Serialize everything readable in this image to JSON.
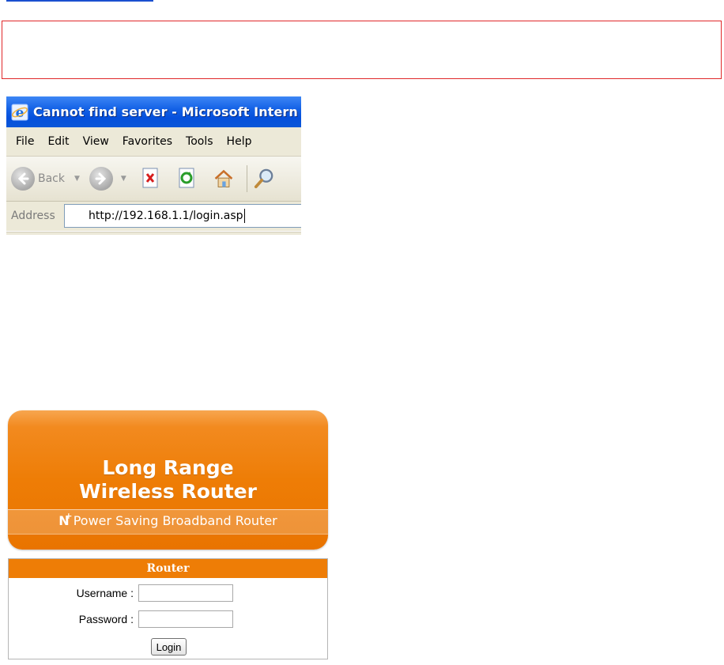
{
  "ie_window": {
    "title": "Cannot find server - Microsoft Intern",
    "menu": [
      "File",
      "Edit",
      "View",
      "Favorites",
      "Tools",
      "Help"
    ],
    "toolbar": {
      "back_label": "Back"
    },
    "address": {
      "label": "Address",
      "url": "http://192.168.1.1/login.asp"
    }
  },
  "banner": {
    "title_line1": "Long Range",
    "title_line2": "Wireless Router",
    "subtitle_prefix": "N",
    "subtitle_sup": "+",
    "subtitle_text": "Power Saving Broadband Router",
    "color": "#ee7d06"
  },
  "login": {
    "header": "Router",
    "username_label": "Username :",
    "username_value": "",
    "password_label": "Password :",
    "password_value": "",
    "submit_label": "Login"
  },
  "colors": {
    "note_border": "#e0282a",
    "ie_title_blue": "#0a56d8",
    "brand_orange": "#ee7d06"
  }
}
